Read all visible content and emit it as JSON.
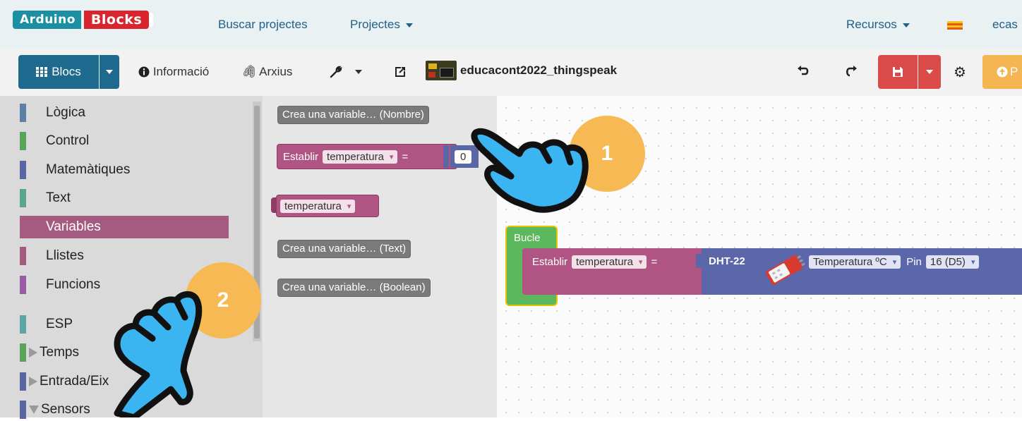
{
  "navbar": {
    "logo_left": "Arduino",
    "logo_right": "Blocks",
    "links": [
      "Buscar projectes",
      "Projectes",
      "Recursos"
    ],
    "user": "ecas"
  },
  "toolbar": {
    "blocs_label": "Blocs",
    "info_label": "Informació",
    "files_label": "Arxius",
    "project_name": "educacont2022_thingspeak",
    "publish_label": "P"
  },
  "categories": [
    {
      "label": "Lògica",
      "color": "#5b80a5"
    },
    {
      "label": "Control",
      "color": "#5ba55b"
    },
    {
      "label": "Matemàtiques",
      "color": "#5b67a5"
    },
    {
      "label": "Text",
      "color": "#5ba58c"
    },
    {
      "label": "Variables",
      "color": "#a55b80",
      "selected": true
    },
    {
      "label": "Llistes",
      "color": "#a55b80"
    },
    {
      "label": "Funcions",
      "color": "#995ba5"
    },
    {
      "label": "ESP",
      "color": "#5ba5a5"
    },
    {
      "label": "Temps",
      "color": "#5ba55b",
      "expand": "collapsed"
    },
    {
      "label": "Entrada/Eix",
      "color": "#5b67a5",
      "expand": "collapsed"
    },
    {
      "label": "Sensors",
      "color": "#5b67a5",
      "expand": "expanded"
    }
  ],
  "flyout": {
    "create_number": "Crea una variable… (Nombre)",
    "set_label": "Establir",
    "var_name": "temperatura",
    "equals": "=",
    "value": "0",
    "create_text": "Crea una variable… (Text)",
    "create_boolean": "Crea una variable… (Boolean)"
  },
  "workspace": {
    "loop_label": "Bucle",
    "set_label": "Establir",
    "var_name": "temperatura",
    "equals": "=",
    "sensor_label": "DHT-22",
    "measure": "Temperatura ºC",
    "pin_label": "Pin",
    "pin_value": "16 (D5)"
  },
  "annotations": {
    "step1": "1",
    "step2": "2",
    "badge_color": "#f6b954",
    "hand_color": "#3bb4f2"
  }
}
